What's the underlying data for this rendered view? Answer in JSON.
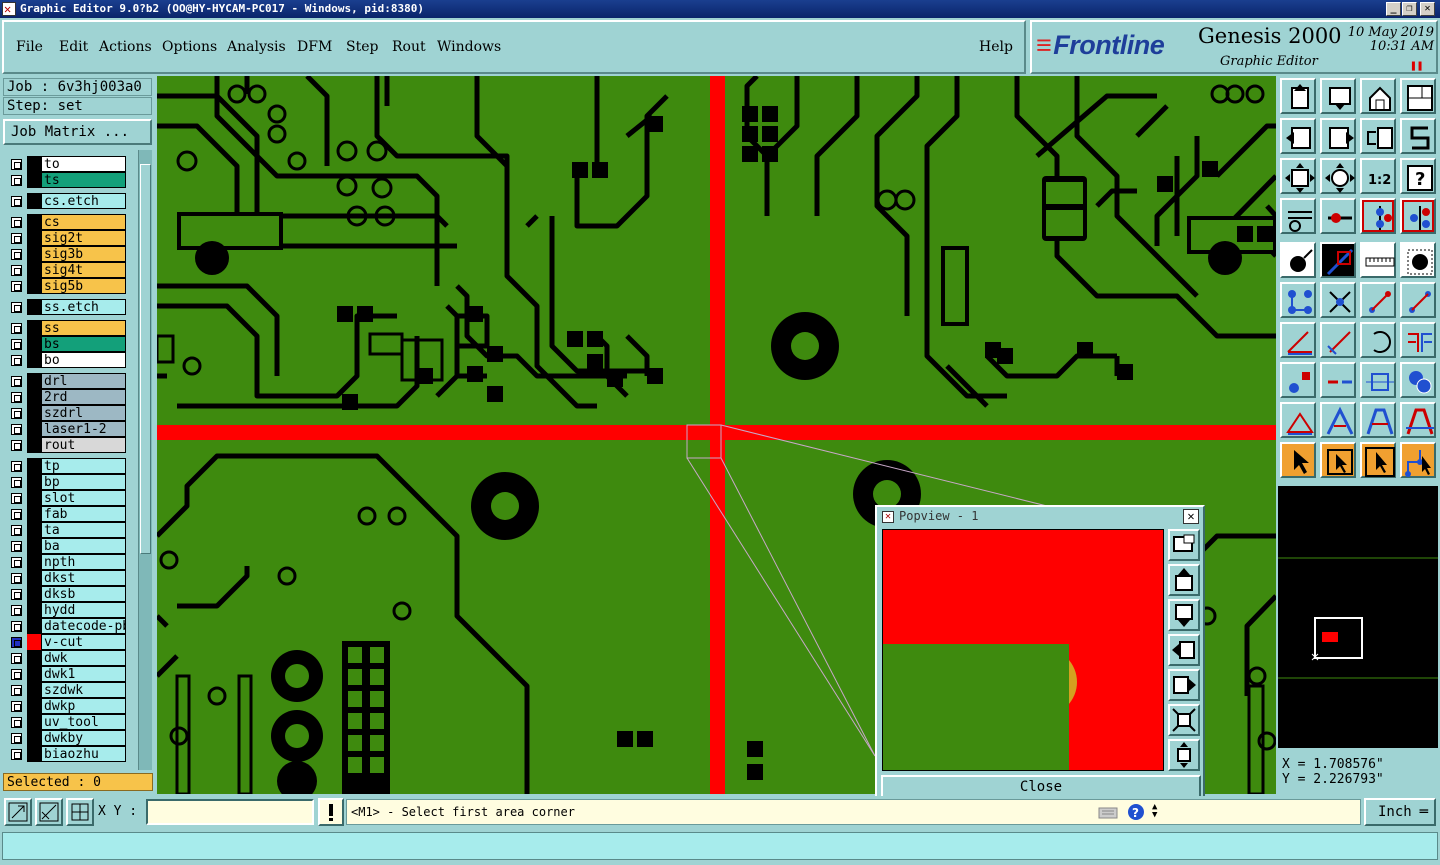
{
  "window": {
    "title": "Graphic Editor 9.0?b2 (OO@HY-HYCAM-PC017 - Windows, pid:8380)",
    "controls": [
      "_",
      "❐",
      "✕"
    ]
  },
  "menu": {
    "items": [
      "File",
      "Edit",
      "Actions",
      "Options",
      "Analysis",
      "DFM",
      "Step",
      "Rout",
      "Windows"
    ],
    "help": "Help"
  },
  "brand": {
    "logo": "Frontline",
    "product": "Genesis 2000",
    "subtitle": "Graphic Editor",
    "date": "10 May 2019",
    "time": "10:31 AM",
    "pause_icon": "pause-icon"
  },
  "job": {
    "job_label": "Job : 6v3hj003a0",
    "step_label": "Step: set",
    "matrix_button": "Job Matrix ..."
  },
  "layers": [
    {
      "name": "to",
      "color": "#ffffff"
    },
    {
      "name": "ts",
      "color": "#13a07a"
    },
    {
      "name": "cs.etch",
      "color": "#a7ecec"
    },
    {
      "name": "cs",
      "color": "#f7c34a"
    },
    {
      "name": "sig2t",
      "color": "#f7c34a"
    },
    {
      "name": "sig3b",
      "color": "#f7c34a"
    },
    {
      "name": "sig4t",
      "color": "#f7c34a"
    },
    {
      "name": "sig5b",
      "color": "#f7c34a"
    },
    {
      "name": "ss.etch",
      "color": "#a7ecec"
    },
    {
      "name": "ss",
      "color": "#f7c34a"
    },
    {
      "name": "bs",
      "color": "#13a07a"
    },
    {
      "name": "bo",
      "color": "#ffffff"
    },
    {
      "name": "drl",
      "color": "#9db8c4"
    },
    {
      "name": "2rd",
      "color": "#9db8c4"
    },
    {
      "name": "szdrl",
      "color": "#9db8c4"
    },
    {
      "name": "laser1-2",
      "color": "#9db8c4"
    },
    {
      "name": "rout",
      "color": "#d8d8d8"
    },
    {
      "name": "tp",
      "color": "#a7ecec"
    },
    {
      "name": "bp",
      "color": "#a7ecec"
    },
    {
      "name": "slot",
      "color": "#a7ecec"
    },
    {
      "name": "fab",
      "color": "#a7ecec"
    },
    {
      "name": "ta",
      "color": "#a7ecec"
    },
    {
      "name": "ba",
      "color": "#a7ecec"
    },
    {
      "name": "npth",
      "color": "#a7ecec"
    },
    {
      "name": "dkst",
      "color": "#a7ecec"
    },
    {
      "name": "dksb",
      "color": "#a7ecec"
    },
    {
      "name": "hydd",
      "color": "#a7ecec"
    },
    {
      "name": "datecode-pbc",
      "color": "#a7ecec"
    },
    {
      "name": "v-cut",
      "color": "#a7ecec"
    },
    {
      "name": "dwk",
      "color": "#a7ecec"
    },
    {
      "name": "dwk1",
      "color": "#a7ecec"
    },
    {
      "name": "szdwk",
      "color": "#a7ecec"
    },
    {
      "name": "dwkp",
      "color": "#a7ecec"
    },
    {
      "name": "uv_tool",
      "color": "#a7ecec"
    },
    {
      "name": "dwkby",
      "color": "#a7ecec"
    },
    {
      "name": "biaozhu",
      "color": "#a7ecec"
    }
  ],
  "selected": "Selected : 0",
  "status": {
    "xy_label": "X Y :",
    "xy_value": "",
    "message": "<M1> - Select first area corner",
    "unit": "Inch"
  },
  "coordinates": {
    "x": "X = 1.708576\"",
    "y": "Y = 2.226793\""
  },
  "popview": {
    "title": "Popview - 1",
    "close": "Close"
  },
  "colors": {
    "canvas": "#3e8a0e",
    "highlight": "#ff0000",
    "panel": "#9fd3d3"
  }
}
